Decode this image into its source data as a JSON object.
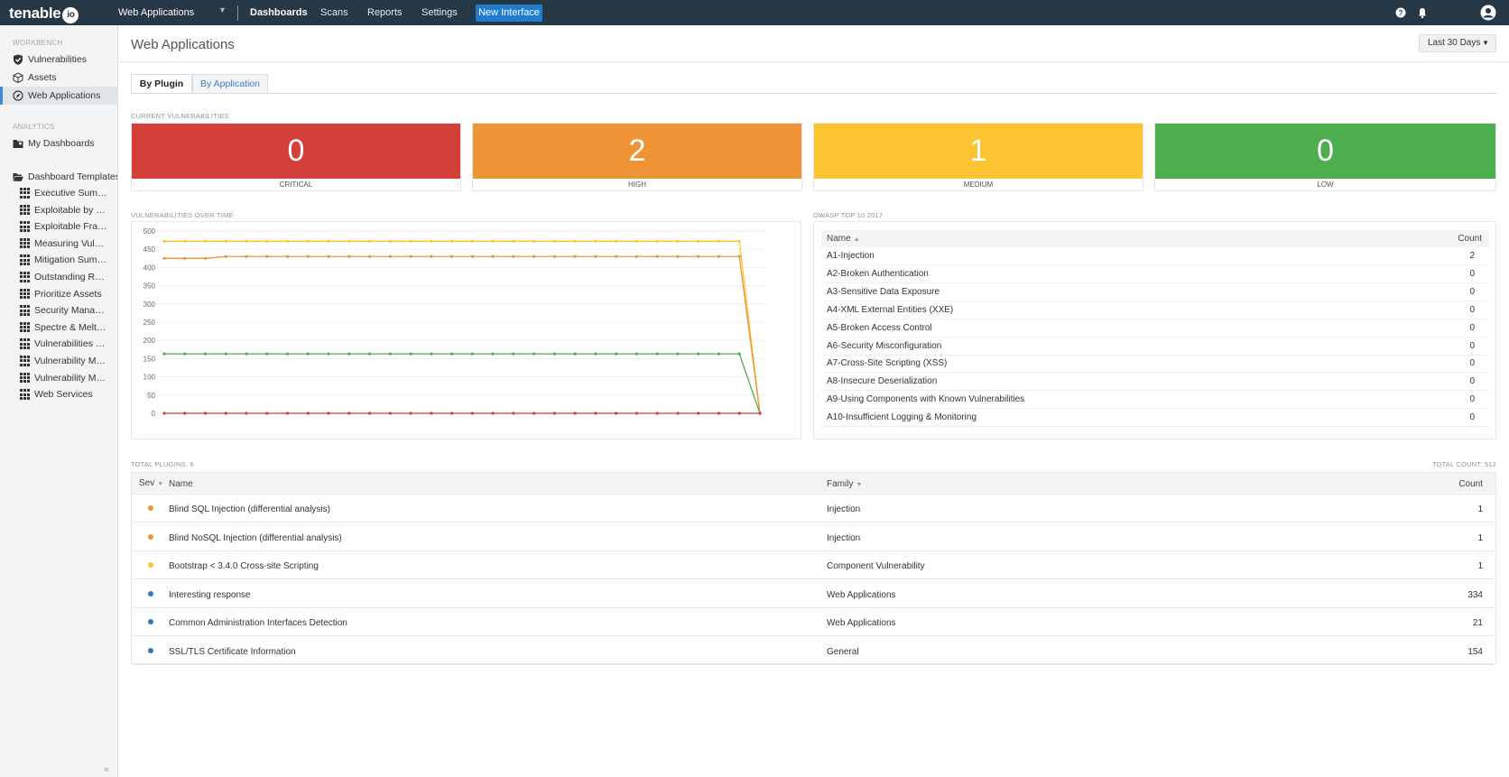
{
  "topbar": {
    "logo": "tenable",
    "logo_suffix": "io",
    "context": "Web Applications",
    "nav": [
      "Dashboards",
      "Scans",
      "Reports",
      "Settings"
    ],
    "new_interface": "New Interface"
  },
  "sidebar": {
    "workbench_header": "WORKBENCH",
    "workbench_items": [
      "Vulnerabilities",
      "Assets",
      "Web Applications"
    ],
    "analytics_header": "ANALYTICS",
    "my_dashboards": "My Dashboards",
    "templates_label": "Dashboard Templates",
    "templates": [
      "Executive Summary",
      "Exploitable by Mal...",
      "Exploitable Frame...",
      "Measuring Vulnera...",
      "Mitigation Summary",
      "Outstanding Reme...",
      "Prioritize Assets",
      "Security Managem...",
      "Spectre & Meltdown",
      "Vulnerabilities by C...",
      "Vulnerability Mana...",
      "Vulnerability Mana...",
      "Web Services"
    ]
  },
  "main": {
    "title": "Web Applications",
    "range": "Last 30 Days",
    "tabs": [
      "By Plugin",
      "By Application"
    ],
    "current_label": "CURRENT VULNERABILITIES",
    "cards": [
      {
        "value": "0",
        "label": "CRITICAL",
        "color": "#d43f3a"
      },
      {
        "value": "2",
        "label": "HIGH",
        "color": "#ee9336"
      },
      {
        "value": "1",
        "label": "MEDIUM",
        "color": "#fdc431"
      },
      {
        "value": "0",
        "label": "LOW",
        "color": "#4cae4c"
      }
    ],
    "chart_label": "VULNERABILITIES OVER TIME",
    "owasp_label": "OWASP TOP 10 2017",
    "owasp_header": {
      "name": "Name",
      "count": "Count"
    },
    "owasp_rows": [
      {
        "name": "A1-Injection",
        "count": "2"
      },
      {
        "name": "A2-Broken Authentication",
        "count": "0"
      },
      {
        "name": "A3-Sensitive Data Exposure",
        "count": "0"
      },
      {
        "name": "A4-XML External Entities (XXE)",
        "count": "0"
      },
      {
        "name": "A5-Broken Access Control",
        "count": "0"
      },
      {
        "name": "A6-Security Misconfiguration",
        "count": "0"
      },
      {
        "name": "A7-Cross-Site Scripting (XSS)",
        "count": "0"
      },
      {
        "name": "A8-Insecure Deserialization",
        "count": "0"
      },
      {
        "name": "A9-Using Components with Known Vulnerabilities",
        "count": "0"
      },
      {
        "name": "A10-Insufficient Logging & Monitoring",
        "count": "0"
      }
    ],
    "total_plugins": "TOTAL PLUGINS: 6",
    "total_count": "TOTAL COUNT: 512",
    "plugin_header": {
      "sev": "Sev",
      "name": "Name",
      "family": "Family",
      "count": "Count"
    },
    "plugins": [
      {
        "name": "Blind SQL Injection (differential analysis)",
        "family": "Injection",
        "count": "1",
        "sev_color": "#ee9336"
      },
      {
        "name": "Blind NoSQL Injection (differential analysis)",
        "family": "Injection",
        "count": "1",
        "sev_color": "#ee9336"
      },
      {
        "name": "Bootstrap < 3.4.0 Cross-site Scripting",
        "family": "Component Vulnerability",
        "count": "1",
        "sev_color": "#fdc431"
      },
      {
        "name": "Interesting response",
        "family": "Web Applications",
        "count": "334",
        "sev_color": "#357abd"
      },
      {
        "name": "Common Administration Interfaces Detection",
        "family": "Web Applications",
        "count": "21",
        "sev_color": "#357abd"
      },
      {
        "name": "SSL/TLS Certificate Information",
        "family": "General",
        "count": "154",
        "sev_color": "#357abd"
      }
    ]
  },
  "chart_data": {
    "type": "line",
    "x_points": 30,
    "ylim": [
      0,
      500
    ],
    "yticks": [
      "0",
      "50",
      "100",
      "150",
      "200",
      "250",
      "300",
      "350",
      "400",
      "450",
      "500"
    ],
    "series": [
      {
        "color": "#fdc431",
        "values": [
          472,
          472,
          472,
          472,
          472,
          472,
          472,
          472,
          472,
          472,
          472,
          472,
          472,
          472,
          472,
          472,
          472,
          472,
          472,
          472,
          472,
          472,
          472,
          472,
          472,
          472,
          472,
          472,
          472,
          0
        ]
      },
      {
        "color": "#ee9336",
        "values": [
          425,
          425,
          425,
          430,
          430,
          430,
          430,
          430,
          430,
          430,
          430,
          430,
          430,
          430,
          430,
          430,
          430,
          430,
          430,
          430,
          430,
          430,
          430,
          430,
          430,
          430,
          430,
          430,
          430,
          0
        ]
      },
      {
        "color": "#4cae4c",
        "values": [
          163,
          163,
          163,
          163,
          163,
          163,
          163,
          163,
          163,
          163,
          163,
          163,
          163,
          163,
          163,
          163,
          163,
          163,
          163,
          163,
          163,
          163,
          163,
          163,
          163,
          163,
          163,
          163,
          163,
          0
        ]
      },
      {
        "color": "#d43f3a",
        "values": [
          0,
          0,
          0,
          0,
          0,
          0,
          0,
          0,
          0,
          0,
          0,
          0,
          0,
          0,
          0,
          0,
          0,
          0,
          0,
          0,
          0,
          0,
          0,
          0,
          0,
          0,
          0,
          0,
          0,
          0
        ]
      }
    ]
  }
}
